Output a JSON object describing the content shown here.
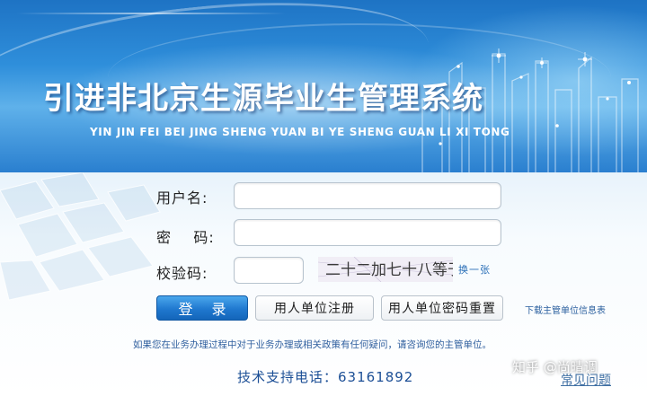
{
  "banner": {
    "title": "引进非北京生源毕业生管理系统",
    "subtitle": "YIN JIN FEI BEI JING SHENG YUAN BI YE SHENG GUAN LI XI TONG"
  },
  "form": {
    "username_label": "用户名:",
    "password_label": "密    码:",
    "captcha_label": "校验码:",
    "username_value": "",
    "password_value": "",
    "captcha_value": "",
    "captcha_image_text": "二十二加七十八等于",
    "captcha_refresh": "换一张"
  },
  "buttons": {
    "login": "登 录",
    "register": "用人单位注册",
    "reset_password": "用人单位密码重置"
  },
  "links": {
    "download": "下载主管单位信息表",
    "faq": "常见问题"
  },
  "footer": {
    "notice": "如果您在业务办理过程中对于业务办理或相关政策有任何疑问，请咨询您的主管单位。",
    "phone": "技术支持电话：63161892"
  },
  "watermark": "知乎 @尚晴调",
  "colors": {
    "banner_blue": "#2f8fdb",
    "login_button": "#1f78cf",
    "link_blue": "#2a6fb7"
  }
}
